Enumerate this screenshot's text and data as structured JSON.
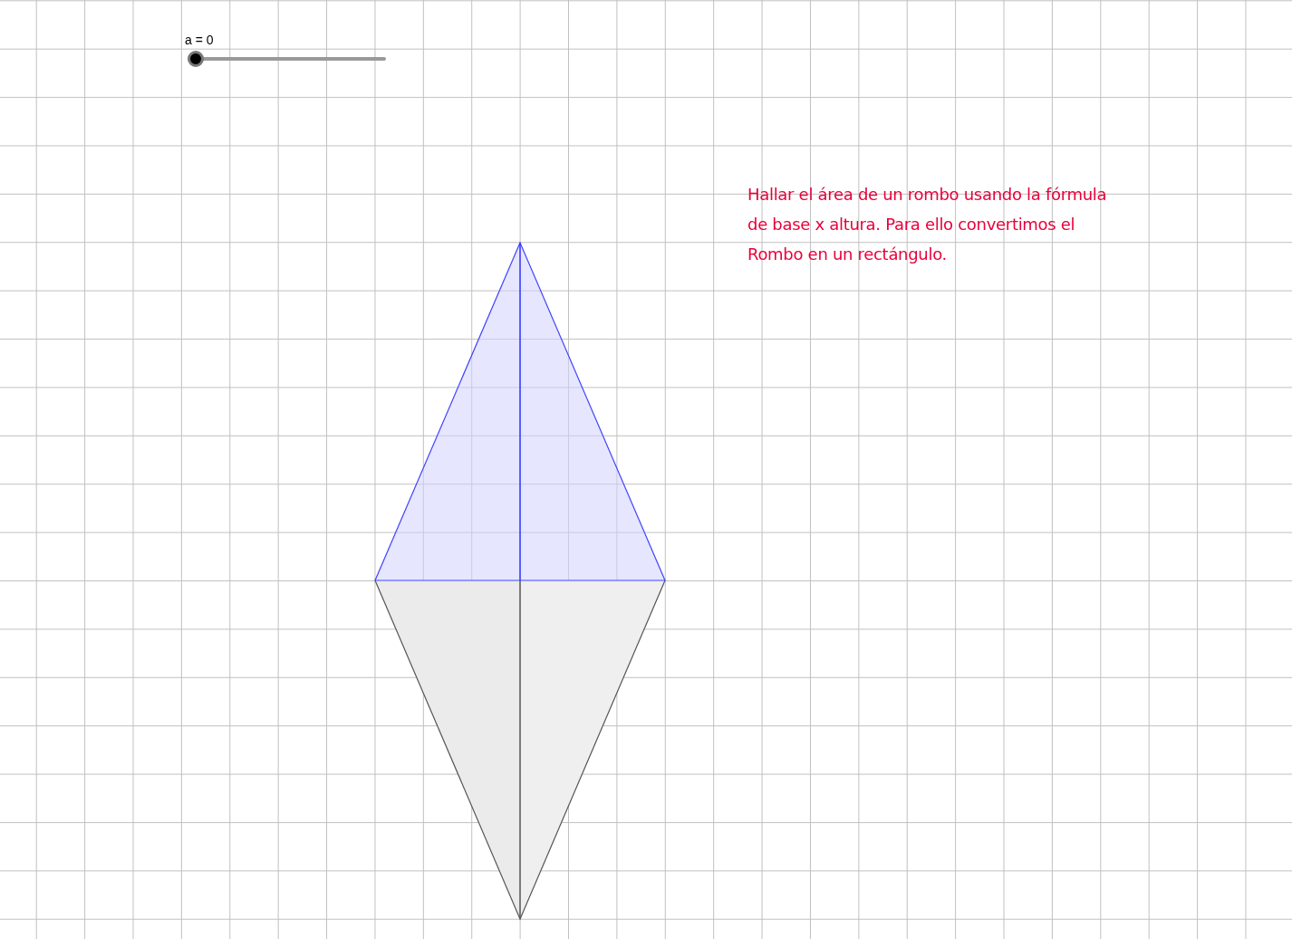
{
  "slider": {
    "label": "a = 0",
    "level": 0
  },
  "note": {
    "lines": [
      "Hallar el área de un rombo usando la fórmula",
      "de base x altura. Para ello convertimos el",
      "Rombo en un rectángulo."
    ]
  }
}
